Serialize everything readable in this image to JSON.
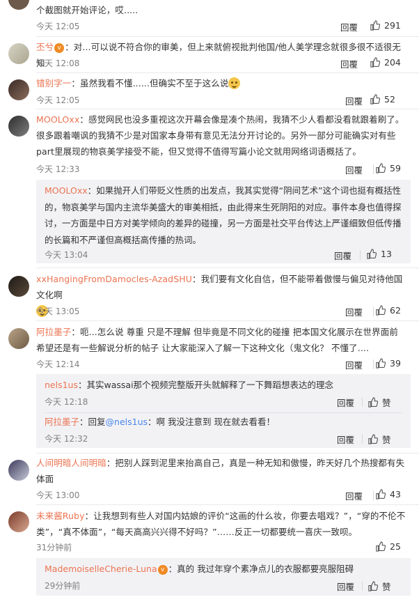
{
  "badge_char": "v",
  "comments": [
    {
      "name": "",
      "text": "个截图就开始评论，哎.....",
      "time": "今天 12:05",
      "reply": "回覆",
      "likes": "291"
    },
    {
      "name": "丕兮",
      "text": "：对...可以说不符合你的审美，但上来就俯视批判他国/他人美学理念就很多很不适很无知",
      "time": "今天 12:08",
      "reply": "回覆",
      "likes": "204"
    },
    {
      "name": "错别字一",
      "text": "：虽然我看不懂......但确实不至于这么说",
      "time": "今天 12:05",
      "reply": "回覆",
      "likes": "52"
    },
    {
      "name": "MOOLOxx",
      "text": "：感觉网民也没多重视这次开幕会像是凑个热闹，我猜不少人看都没看就跟着刷了。很多跟着嘲讽的我猜不少是对国家本身带有意见无法分开讨论的。另外一部分可能确实对有些part里展现的物哀美学接受不能，但又觉得不值得写篇小论文就用网络词语概括了。",
      "time": "今天 12:33",
      "reply": "回覆",
      "likes": "59"
    },
    {
      "name": "xxHangingFromDamocles-AzadSHU",
      "text": "：我们要有文化自信，但不能带着傲慢与偏见对待他国文化啊",
      "time": "今天 13:05",
      "reply": "回覆",
      "likes": "62"
    },
    {
      "name": "阿拉墨子",
      "text": "：呃...怎么说 尊重 只是不理解 但毕竟是不同文化的碰撞 把本国文化展示在世界面前 希望还是有一些解说分析的帖子 让大家能深入了解一下这种文化（鬼文化？ 不懂了....",
      "time": "今天 12:14",
      "reply": "回覆",
      "likes": "39"
    },
    {
      "name": "人间明暗人间明暗",
      "text": "：把别人踩到泥里来抬高自己，真是一种无知和傲慢，昨天好几个热搜都有失体面",
      "time": "今天 13:00",
      "reply": "回覆",
      "likes": "43"
    },
    {
      "name": "未来酱Ruby",
      "text": "：让我想到有些人对国内姑娘的评价“这画的什么妆，你要去唱戏？”，“穿的不伦不类”，“真不体面”，“每天高高兴兴得不好吗？”……反正一切都要统一喜庆一致呗。",
      "time": "31分钟前",
      "reply": "",
      "likes": "25"
    }
  ],
  "subs": [
    {
      "name": "MOOLOxx",
      "text": "：如果抛开人们带贬义性质的出发点，我其实觉得“阴间艺术”这个词也挺有概括性的，物哀美学与国内主流华美盛大的审美相抵，由此得来生死阴阳的对应。事件本身也值得探讨，一方面是中日方对美学倾向的差异的碰撞，另一方面是社交平台传达上严谨细致但低传播的长篇和不严谨但高概括高传播的热词。",
      "time": "今天 13:04",
      "reply": "回覆",
      "likes": "13"
    },
    {
      "name": "nels1us",
      "text": "：其实wassai那个视频完整版开头就解释了一下舞蹈想表达的理念",
      "time": "今天 12:18",
      "reply": "回覆",
      "likes": "赞"
    },
    {
      "name": "阿拉墨子",
      "pre": "：回复",
      "mention": "@nels1us",
      "text": "：啊 我没注意到 现在就去看看！",
      "time": "今天 12:32",
      "reply": "回覆",
      "likes": "赞"
    },
    {
      "name": "MademoiselleCherie-Luna",
      "text": "：真的 我过年穿个素净点儿的衣服都要亮服阻碍",
      "time": "29分钟前",
      "reply": "回覆",
      "likes": "赞"
    }
  ],
  "colors": {
    "name": "#eb7350",
    "mention": "#4a86e8",
    "time": "#808080",
    "sub_bg": "#f2f2f5"
  }
}
